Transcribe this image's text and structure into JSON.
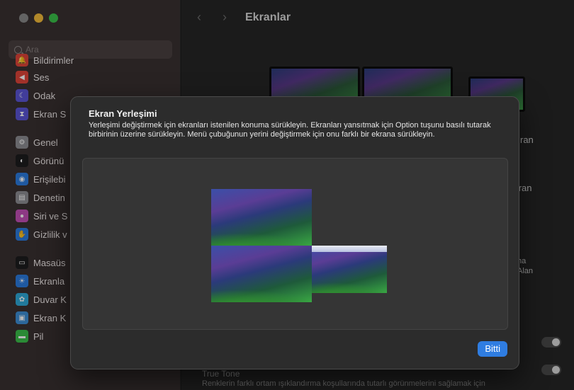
{
  "window": {
    "title": "Ekranlar",
    "back_arrow": "‹",
    "forward_arrow": "›"
  },
  "search": {
    "placeholder": "Ara"
  },
  "sidebar": {
    "items": [
      {
        "label": "Bildirimler",
        "icon": "bell-icon",
        "color": "#e0443a"
      },
      {
        "label": "Ses",
        "icon": "speaker-icon",
        "color": "#e0443a"
      },
      {
        "label": "Odak",
        "icon": "moon-icon",
        "color": "#5a55d6"
      },
      {
        "label": "Ekran S",
        "icon": "hourglass-icon",
        "color": "#5a55d6"
      },
      {
        "label": "Genel",
        "icon": "gear-icon",
        "color": "#8e8e93"
      },
      {
        "label": "Görünü",
        "icon": "appearance-icon",
        "color": "#1c1c1e"
      },
      {
        "label": "Erişilebi",
        "icon": "accessibility-icon",
        "color": "#2c7ce0"
      },
      {
        "label": "Denetin",
        "icon": "control-center-icon",
        "color": "#8e8e93"
      },
      {
        "label": "Siri ve S",
        "icon": "siri-icon",
        "color": "#c44fb8"
      },
      {
        "label": "Gizlilik v",
        "icon": "hand-icon",
        "color": "#2c7ce0"
      },
      {
        "label": "Masaüs",
        "icon": "dock-icon",
        "color": "#1c1c1e"
      },
      {
        "label": "Ekranla",
        "icon": "sun-icon",
        "color": "#2c7ce0"
      },
      {
        "label": "Duvar K",
        "icon": "flower-icon",
        "color": "#2ea9d9"
      },
      {
        "label": "Ekran K",
        "icon": "screensaver-icon",
        "color": "#3d8fd6"
      },
      {
        "label": "Pil",
        "icon": "battery-icon",
        "color": "#3bbf4a"
      }
    ]
  },
  "background_panel": {
    "label_ran": "ran",
    "label_ekran": "ekran",
    "label_ha": "ha",
    "label_alan": "Alan",
    "true_tone_title": "True Tone",
    "true_tone_desc": "Renklerin farklı ortam ışıklandırma koşullarında tutarlı görünmelerini sağlamak için"
  },
  "sheet": {
    "title": "Ekran Yerleşimi",
    "description": "Yerleşimi değiştirmek için ekranları istenilen konuma sürükleyin. Ekranları yansıtmak için Option tuşunu basılı tutarak birbirinin üzerine sürükleyin. Menü çubuğunun yerini değiştirmek için onu farklı bir ekrana sürükleyin.",
    "done_label": "Bitti",
    "accent": "#2f7de1"
  }
}
